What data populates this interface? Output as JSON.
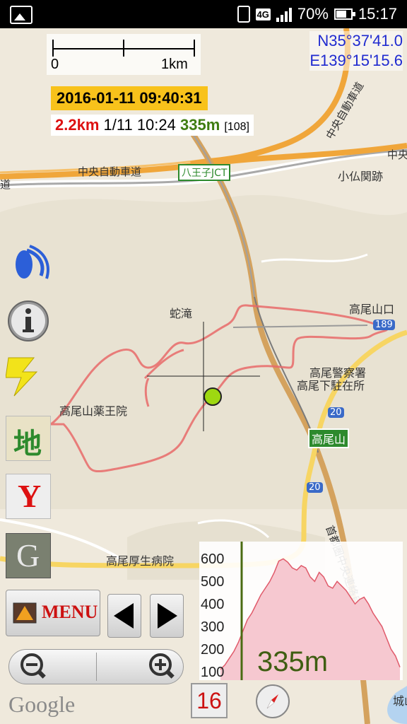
{
  "status_bar": {
    "battery": "70%",
    "network": "4G",
    "time": "15:17",
    "icons": [
      "image-icon",
      "vibrate-icon",
      "signal-icon",
      "battery-icon"
    ]
  },
  "scale": {
    "zero": "0",
    "distance": "1km"
  },
  "coords": {
    "lat": "N35°37'41.0",
    "lon": "E139°15'15.6"
  },
  "info": {
    "datetime": "2016-01-11 09:40:31",
    "distance": "2.2km",
    "time": "1/11 10:24",
    "altitude": "335m",
    "count": "[108]"
  },
  "map_labels": {
    "chuo_expressway": "中央自動車道",
    "chuo_expressway_left": "道",
    "chuo_expressway_vertical": "中央自動車道",
    "chuo_right": "中央",
    "hachioji_jct": "八王子JCT",
    "kobotoke": "小仏関跡",
    "jadaki": "蛇滝",
    "takaosanguchi": "高尾山口",
    "route_badge_189": "189",
    "police": "高尾警察署",
    "police2": "高尾下駐在所",
    "yakuoin": "高尾山薬王院",
    "route_badge_20": "20",
    "route_badge_20b": "20",
    "takaosan": "高尾山",
    "hospital": "高尾厚生病院",
    "shutoken": "首都圏中央連絡自動車道",
    "shiro": "城山"
  },
  "side_buttons": {
    "map": "地",
    "yahoo": "Y",
    "google_sat": "G"
  },
  "menu_label": "MENU",
  "google_brand": "Google",
  "zoom_level": "16",
  "elevation": {
    "y_labels": [
      "600",
      "500",
      "400",
      "300",
      "200",
      "100"
    ],
    "current": "335m",
    "fill_color": "#f6c8d0",
    "line_color": "#e05a6a"
  },
  "colors": {
    "track": "#e86a6a",
    "expressway": "#f0a63a",
    "coords": "#1f2ad0",
    "date_bg": "#f8c21b"
  }
}
